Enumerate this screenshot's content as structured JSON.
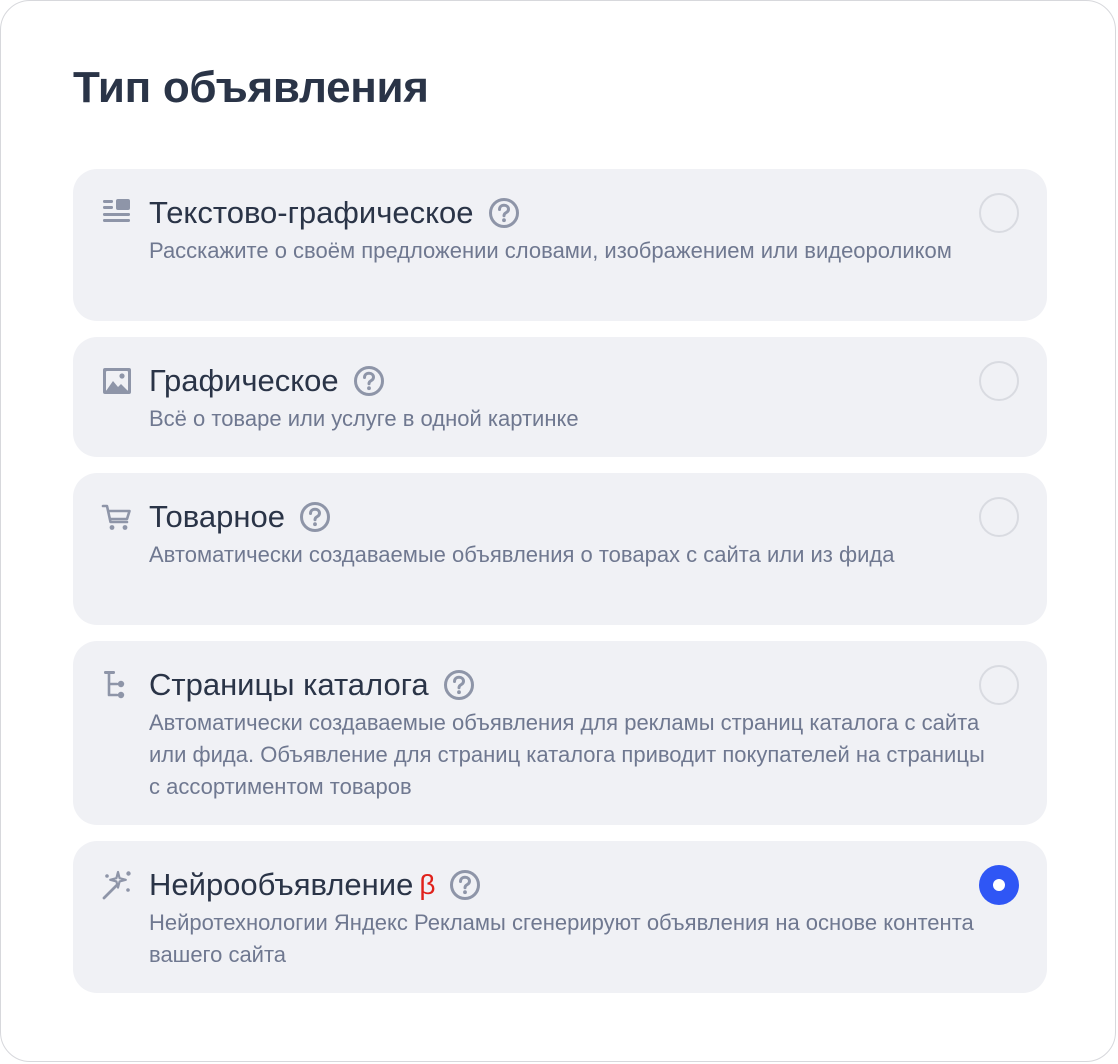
{
  "page_title": "Тип объявления",
  "options": [
    {
      "label": "Текстово-графическое",
      "description": "Расскажите о своём предложении словами, изображением или видеороликом",
      "icon": "text-graphic-icon",
      "selected": false
    },
    {
      "label": "Графическое",
      "description": "Всё о товаре или услуге в одной картинке",
      "icon": "image-icon",
      "selected": false
    },
    {
      "label": "Товарное",
      "description": "Автоматически создаваемые объявления о товарах с сайта или из фида",
      "icon": "cart-icon",
      "selected": false
    },
    {
      "label": "Страницы каталога",
      "description": "Автоматически создаваемые объявления для рекламы страниц каталога с сайта или фида. Объявление для страниц каталога приводит покупателей на страницы с ассортиментом товаров",
      "icon": "catalog-tree-icon",
      "selected": false
    },
    {
      "label": "Нейрообъявление",
      "badge": "β",
      "description": "Нейротехнологии Яндекс Рекламы сгенерируют объявления на основе контента вашего сайта",
      "icon": "magic-wand-icon",
      "selected": true
    }
  ],
  "colors": {
    "accent": "#2f56f5",
    "beta": "#e0211b",
    "card_bg": "#f0f1f5",
    "title": "#2a3447",
    "muted": "#6f7890"
  }
}
